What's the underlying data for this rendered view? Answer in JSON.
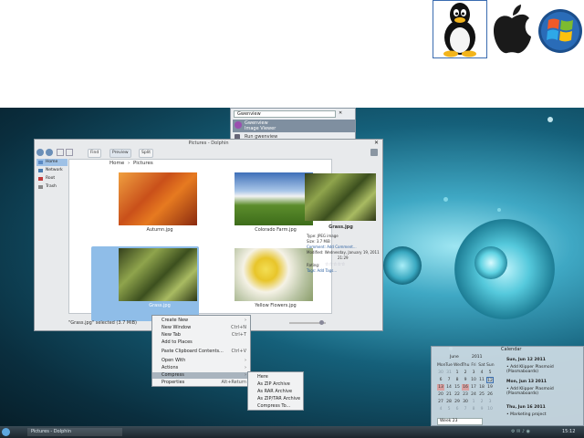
{
  "os_logos": [
    "linux-tux-logo",
    "apple-logo",
    "windows-logo"
  ],
  "krunner": {
    "query": "Gwenview",
    "results": [
      {
        "title": "Gwenview",
        "subtitle": "Image Viewer"
      },
      {
        "title": "Run gwenview"
      }
    ]
  },
  "dolphin": {
    "title": "Pictures - Dolphin",
    "toolbar": {
      "find_label": "Find",
      "preview_label": "Preview",
      "split_label": "Split"
    },
    "places": [
      "Home",
      "Network",
      "Root",
      "Trash"
    ],
    "breadcrumb": {
      "home": "Home",
      "current": "Pictures"
    },
    "files": [
      {
        "name": "Autumn.jpg"
      },
      {
        "name": "Colorado Farm.jpg"
      },
      {
        "name": "Grass.jpg"
      },
      {
        "name": "Yellow Flowers.jpg"
      }
    ],
    "info": {
      "file_name": "Grass.jpg",
      "type_line": "Type: JPEG image",
      "size_line": "Size: 3.7 MiB",
      "comment_line": "Comment: Add Comment...",
      "modified_line": "Modified: Wednesday, January 19, 2011",
      "modified_time": "21:29",
      "rating_label": "Rating:",
      "tags_line": "Tags: Add Tags..."
    },
    "status": "\"Grass.jpg\" selected (3.7 MiB)"
  },
  "context_menu": {
    "items": [
      {
        "label": "Create New",
        "shortcut": ""
      },
      {
        "label": "New Window",
        "shortcut": "Ctrl+N"
      },
      {
        "label": "New Tab",
        "shortcut": "Ctrl+T"
      },
      {
        "label": "Add to Places",
        "shortcut": ""
      },
      {
        "label": "Paste Clipboard Contents...",
        "shortcut": "Ctrl+V"
      },
      {
        "label": "Open With",
        "shortcut": ""
      },
      {
        "label": "Actions",
        "shortcut": ""
      },
      {
        "label": "Compress",
        "shortcut": ""
      },
      {
        "label": "Properties",
        "shortcut": "Alt+Return"
      }
    ],
    "submenu": [
      "Here",
      "As ZIP Archive",
      "As RAR Archive",
      "As ZIP/TAR Archive",
      "Compress To..."
    ]
  },
  "calendar": {
    "title": "Calendar",
    "month": "June",
    "year": "2011",
    "weekdays": [
      "Mon",
      "Tue",
      "Wed",
      "Thu",
      "Fri",
      "Sat",
      "Sun"
    ],
    "days": [
      "30",
      "31",
      "1",
      "2",
      "3",
      "4",
      "5",
      "6",
      "7",
      "8",
      "9",
      "10",
      "11",
      "12",
      "13",
      "14",
      "15",
      "16",
      "17",
      "18",
      "19",
      "20",
      "21",
      "22",
      "23",
      "24",
      "25",
      "26",
      "27",
      "28",
      "29",
      "30",
      "1",
      "2",
      "3",
      "4",
      "5",
      "6",
      "7",
      "8",
      "9",
      "10"
    ],
    "week_field": "Week 23",
    "events": [
      {
        "date": "Sun, Jun 12 2011",
        "text": "• Add Klipper Plasmoid (Plasmaboards)"
      },
      {
        "date": "Mon, Jun 13 2011",
        "text": "• Add Klipper Plasmoid (Plasmaboards)"
      },
      {
        "date": "Thu, Jun 16 2011",
        "text": "• Marketing project"
      }
    ]
  },
  "taskbar": {
    "task_label": "Pictures - Dolphin",
    "clock": "15:12"
  }
}
